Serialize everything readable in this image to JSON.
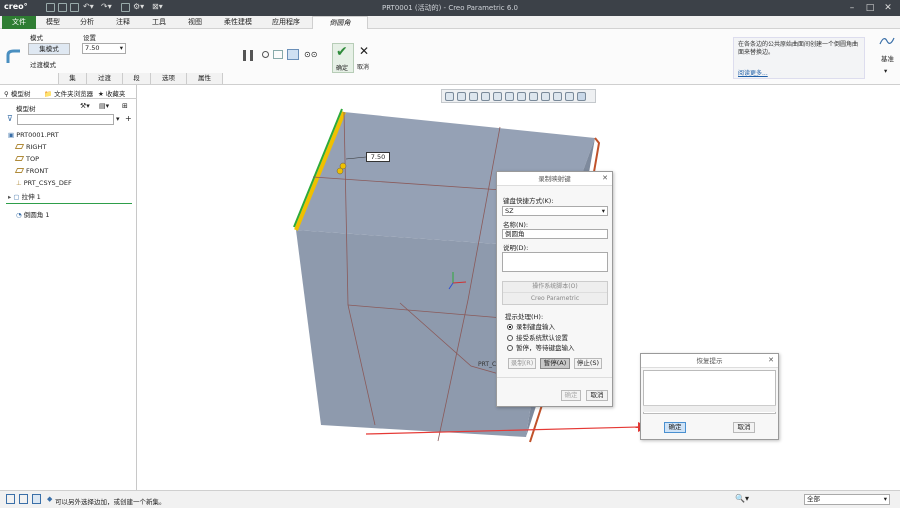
{
  "app": {
    "brand": "creo°",
    "window_title": "PRT0001 (活动的) - Creo Parametric 6.0"
  },
  "ribbon_tabs": [
    "文件",
    "模型",
    "分析",
    "注释",
    "工具",
    "视图",
    "柔性建模",
    "应用程序",
    "倒圆角"
  ],
  "ribbon": {
    "mode_label": "模式",
    "settings_label": "设置",
    "set_mode": "集模式",
    "transition_mode": "过渡模式",
    "radius_value": "7.50",
    "ok_label": "确定",
    "cancel_label": "取消",
    "help_text": "在各条边的公共原始曲面间创建一个倒圆角曲面来替换边。",
    "learn_more": "阅读更多...",
    "right_label": "基准",
    "subtabs": [
      "集",
      "过渡",
      "段",
      "选项",
      "属性"
    ]
  },
  "left_panel": {
    "tabs": [
      "模型树",
      "文件夹浏览器",
      "收藏夹"
    ],
    "tree_header": "模型树",
    "items": [
      "PRT0001.PRT",
      "RIGHT",
      "TOP",
      "FRONT",
      "PRT_CSYS_DEF",
      "拉伸 1",
      "倒圆角 1"
    ]
  },
  "viewport": {
    "dimension": "7.50",
    "csys_label": "PRT_CSYS_DEF"
  },
  "record_dialog": {
    "title": "录制映射键",
    "shortcut_label": "键盘快捷方式(K):",
    "shortcut_value": "SZ",
    "name_label": "名称(N):",
    "name_value": "倒圆角",
    "desc_label": "说明(D):",
    "os_script_label": "操作系统脚本(O)",
    "os_script_sub": "Creo Parametric",
    "prompt_label": "提示处理(H):",
    "options": [
      "录制键盘输入",
      "接受系统默认设置",
      "暂停，等待键盘输入"
    ],
    "selected_option": 0,
    "record_btn": "录制(R)",
    "pause_btn": "暂停(A)",
    "stop_btn": "停止(S)",
    "ok": "确定",
    "cancel": "取消"
  },
  "resume_dialog": {
    "title": "恢复提示",
    "ok": "确定",
    "cancel": "取消"
  },
  "status": {
    "message": "可以另外选择边加，或创建一个新集。",
    "filter_value": "全部"
  },
  "colors": {
    "titlebar": "#3c4148",
    "file_tab": "#2e7d32",
    "active_tab": "#f1f1f1",
    "model_face": "#8e9aad",
    "highlight_edge": "#f0c000",
    "arrow": "#e53935"
  }
}
